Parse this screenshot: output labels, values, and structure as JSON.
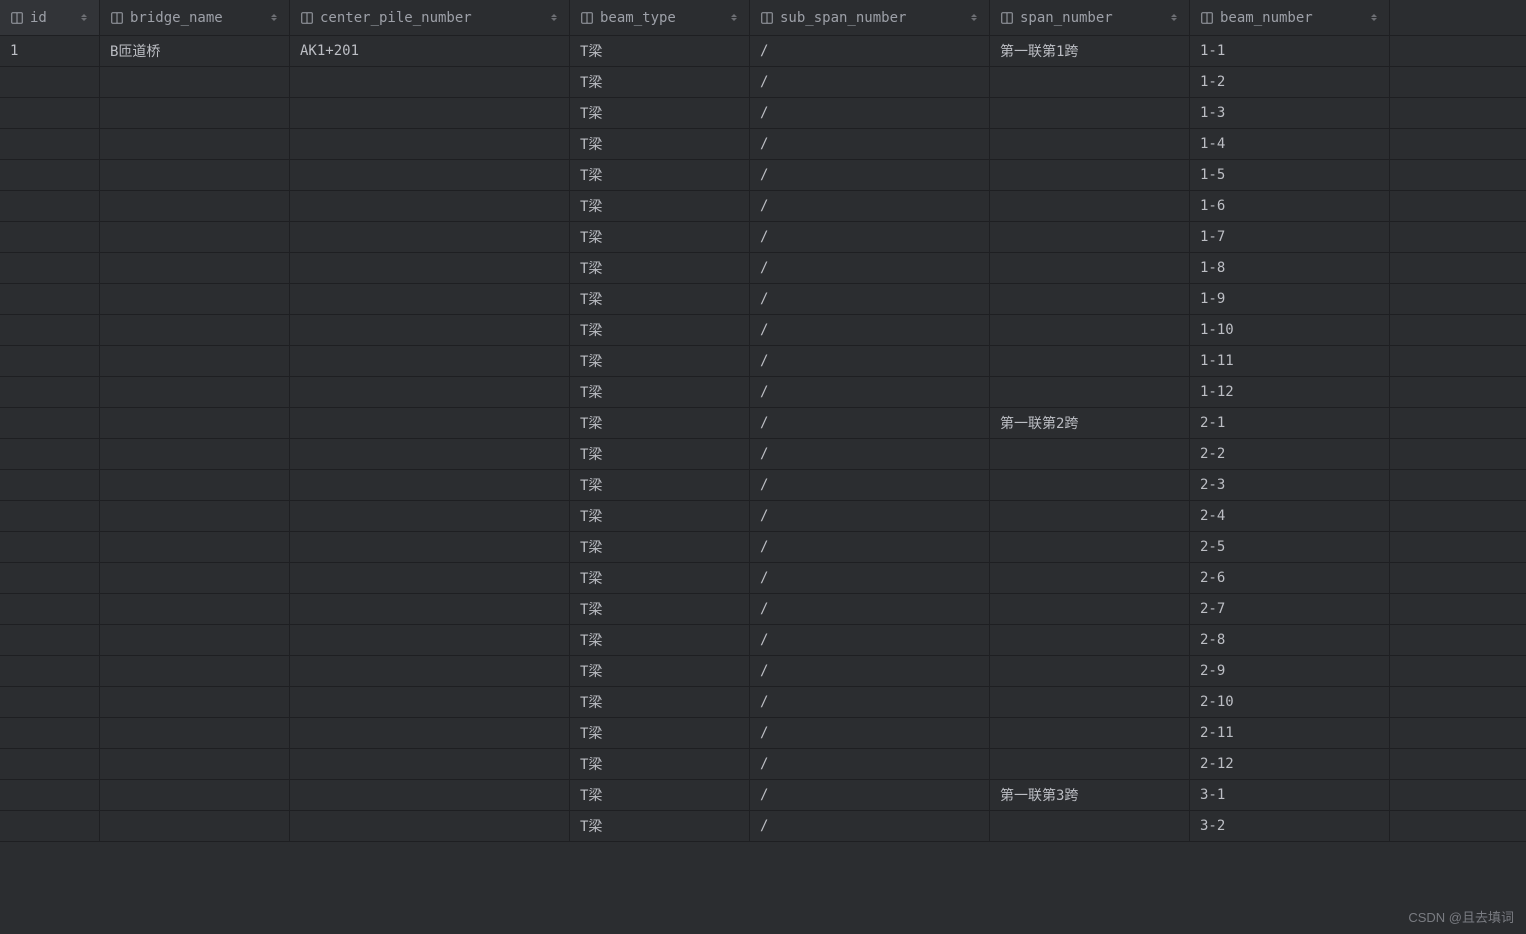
{
  "columns": [
    {
      "key": "id",
      "label": "id",
      "class": "col-id"
    },
    {
      "key": "bridge_name",
      "label": "bridge_name",
      "class": "col-bridge"
    },
    {
      "key": "center_pile_number",
      "label": "center_pile_number",
      "class": "col-center"
    },
    {
      "key": "beam_type",
      "label": "beam_type",
      "class": "col-beamtype"
    },
    {
      "key": "sub_span_number",
      "label": "sub_span_number",
      "class": "col-subspan"
    },
    {
      "key": "span_number",
      "label": "span_number",
      "class": "col-span"
    },
    {
      "key": "beam_number",
      "label": "beam_number",
      "class": "col-beamnum"
    }
  ],
  "rows": [
    {
      "id": "1",
      "bridge_name": "B匝道桥",
      "center_pile_number": "AK1+201",
      "beam_type": "T梁",
      "sub_span_number": "/",
      "span_number": "第一联第1跨",
      "beam_number": "1-1"
    },
    {
      "id": "",
      "bridge_name": "",
      "center_pile_number": "",
      "beam_type": "T梁",
      "sub_span_number": "/",
      "span_number": "",
      "beam_number": "1-2"
    },
    {
      "id": "",
      "bridge_name": "",
      "center_pile_number": "",
      "beam_type": "T梁",
      "sub_span_number": "/",
      "span_number": "",
      "beam_number": "1-3"
    },
    {
      "id": "",
      "bridge_name": "",
      "center_pile_number": "",
      "beam_type": "T梁",
      "sub_span_number": "/",
      "span_number": "",
      "beam_number": "1-4"
    },
    {
      "id": "",
      "bridge_name": "",
      "center_pile_number": "",
      "beam_type": "T梁",
      "sub_span_number": "/",
      "span_number": "",
      "beam_number": "1-5"
    },
    {
      "id": "",
      "bridge_name": "",
      "center_pile_number": "",
      "beam_type": "T梁",
      "sub_span_number": "/",
      "span_number": "",
      "beam_number": "1-6"
    },
    {
      "id": "",
      "bridge_name": "",
      "center_pile_number": "",
      "beam_type": "T梁",
      "sub_span_number": "/",
      "span_number": "",
      "beam_number": "1-7"
    },
    {
      "id": "",
      "bridge_name": "",
      "center_pile_number": "",
      "beam_type": "T梁",
      "sub_span_number": "/",
      "span_number": "",
      "beam_number": "1-8"
    },
    {
      "id": "",
      "bridge_name": "",
      "center_pile_number": "",
      "beam_type": "T梁",
      "sub_span_number": "/",
      "span_number": "",
      "beam_number": "1-9"
    },
    {
      "id": "",
      "bridge_name": "",
      "center_pile_number": "",
      "beam_type": "T梁",
      "sub_span_number": "/",
      "span_number": "",
      "beam_number": "1-10"
    },
    {
      "id": "",
      "bridge_name": "",
      "center_pile_number": "",
      "beam_type": "T梁",
      "sub_span_number": "/",
      "span_number": "",
      "beam_number": "1-11"
    },
    {
      "id": "",
      "bridge_name": "",
      "center_pile_number": "",
      "beam_type": "T梁",
      "sub_span_number": "/",
      "span_number": "",
      "beam_number": "1-12"
    },
    {
      "id": "",
      "bridge_name": "",
      "center_pile_number": "",
      "beam_type": "T梁",
      "sub_span_number": "/",
      "span_number": "第一联第2跨",
      "beam_number": "2-1"
    },
    {
      "id": "",
      "bridge_name": "",
      "center_pile_number": "",
      "beam_type": "T梁",
      "sub_span_number": "/",
      "span_number": "",
      "beam_number": "2-2"
    },
    {
      "id": "",
      "bridge_name": "",
      "center_pile_number": "",
      "beam_type": "T梁",
      "sub_span_number": "/",
      "span_number": "",
      "beam_number": "2-3"
    },
    {
      "id": "",
      "bridge_name": "",
      "center_pile_number": "",
      "beam_type": "T梁",
      "sub_span_number": "/",
      "span_number": "",
      "beam_number": "2-4"
    },
    {
      "id": "",
      "bridge_name": "",
      "center_pile_number": "",
      "beam_type": "T梁",
      "sub_span_number": "/",
      "span_number": "",
      "beam_number": "2-5"
    },
    {
      "id": "",
      "bridge_name": "",
      "center_pile_number": "",
      "beam_type": "T梁",
      "sub_span_number": "/",
      "span_number": "",
      "beam_number": "2-6"
    },
    {
      "id": "",
      "bridge_name": "",
      "center_pile_number": "",
      "beam_type": "T梁",
      "sub_span_number": "/",
      "span_number": "",
      "beam_number": "2-7"
    },
    {
      "id": "",
      "bridge_name": "",
      "center_pile_number": "",
      "beam_type": "T梁",
      "sub_span_number": "/",
      "span_number": "",
      "beam_number": "2-8"
    },
    {
      "id": "",
      "bridge_name": "",
      "center_pile_number": "",
      "beam_type": "T梁",
      "sub_span_number": "/",
      "span_number": "",
      "beam_number": "2-9"
    },
    {
      "id": "",
      "bridge_name": "",
      "center_pile_number": "",
      "beam_type": "T梁",
      "sub_span_number": "/",
      "span_number": "",
      "beam_number": "2-10"
    },
    {
      "id": "",
      "bridge_name": "",
      "center_pile_number": "",
      "beam_type": "T梁",
      "sub_span_number": "/",
      "span_number": "",
      "beam_number": "2-11"
    },
    {
      "id": "",
      "bridge_name": "",
      "center_pile_number": "",
      "beam_type": "T梁",
      "sub_span_number": "/",
      "span_number": "",
      "beam_number": "2-12"
    },
    {
      "id": "",
      "bridge_name": "",
      "center_pile_number": "",
      "beam_type": "T梁",
      "sub_span_number": "/",
      "span_number": "第一联第3跨",
      "beam_number": "3-1"
    },
    {
      "id": "",
      "bridge_name": "",
      "center_pile_number": "",
      "beam_type": "T梁",
      "sub_span_number": "/",
      "span_number": "",
      "beam_number": "3-2"
    }
  ],
  "watermark": "CSDN @且去填词"
}
